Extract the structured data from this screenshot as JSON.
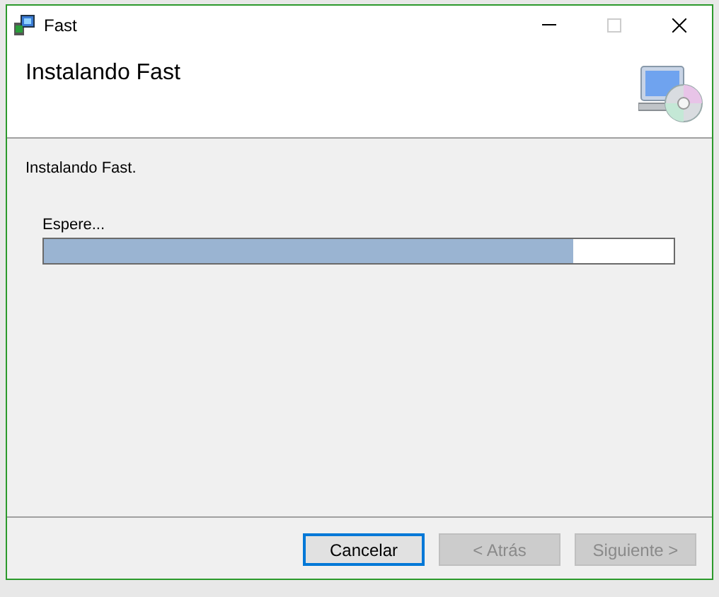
{
  "window": {
    "title": "Fast"
  },
  "header": {
    "title": "Instalando Fast"
  },
  "body": {
    "message": "Instalando Fast.",
    "progress": {
      "label": "Espere...",
      "level": 0.84
    }
  },
  "buttons": [
    {
      "label": "Cancelar",
      "disabled": false,
      "focused": true
    },
    {
      "label": "< Atrás",
      "disabled": true,
      "focused": false
    },
    {
      "label": "Siguiente >",
      "disabled": true,
      "focused": false
    }
  ]
}
